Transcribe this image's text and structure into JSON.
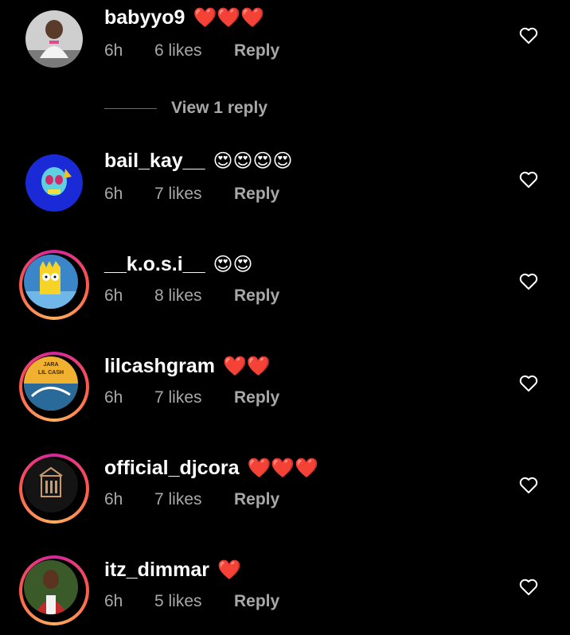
{
  "comments": [
    {
      "username": "babyyo9",
      "emojis": "❤️❤️❤️",
      "time": "6h",
      "likes": "6 likes",
      "reply": "Reply"
    },
    {
      "username": "bail_kay__",
      "emojis": "😍😍😍😍",
      "time": "6h",
      "likes": "7 likes",
      "reply": "Reply"
    },
    {
      "username": "__k.o.s.i__",
      "emojis": "😍😍",
      "time": "6h",
      "likes": "8 likes",
      "reply": "Reply"
    },
    {
      "username": "lilcashgram",
      "emojis": "❤️❤️",
      "time": "6h",
      "likes": "7 likes",
      "reply": "Reply"
    },
    {
      "username": "official_djcora",
      "emojis": "❤️❤️❤️",
      "time": "6h",
      "likes": "7 likes",
      "reply": "Reply"
    },
    {
      "username": "itz_dimmar",
      "emojis": "❤️",
      "time": "6h",
      "likes": "5 likes",
      "reply": "Reply"
    }
  ],
  "view_replies": "View 1 reply",
  "avatar_text": {
    "lilcash_top": "JARA",
    "lilcash_bottom": "LIL CASH"
  },
  "colors": {
    "background": "#000000",
    "secondary_text": "#a8a8a8",
    "story_ring": "#d6249f"
  }
}
